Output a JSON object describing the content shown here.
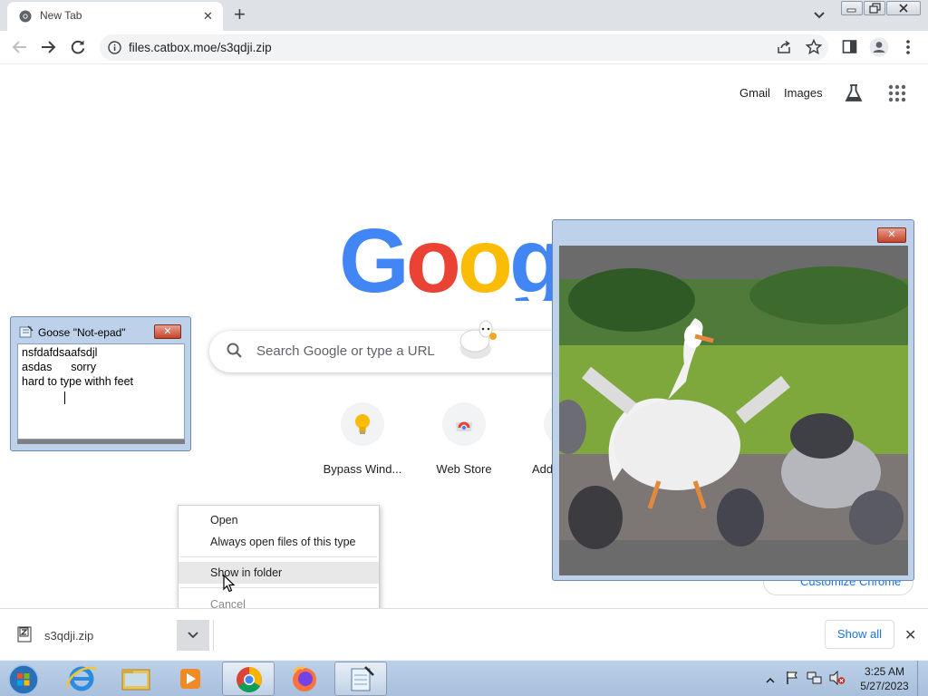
{
  "browser": {
    "tab": {
      "title": "New Tab"
    },
    "address_bar": {
      "url": "files.catbox.moe/s3qdji.zip"
    }
  },
  "ntp": {
    "header_links": {
      "gmail": "Gmail",
      "images": "Images"
    },
    "logo": {
      "visible_letters": "Googl"
    },
    "search": {
      "placeholder": "Search Google or type a URL"
    },
    "shortcuts": [
      {
        "label": "Bypass Wind...",
        "icon": "lightbulb-icon"
      },
      {
        "label": "Web Store",
        "icon": "webstore-icon"
      },
      {
        "label": "Add",
        "icon": "add-shortcut-icon"
      }
    ],
    "customize": {
      "label": "Customize Chrome"
    }
  },
  "notepad": {
    "title": "Goose \"Not-epad\"",
    "lines": [
      "nsfdafdsaafsdjl",
      "asdas      sorry",
      "hard to type withh feet"
    ]
  },
  "context_menu": {
    "items": [
      {
        "label": "Open",
        "enabled": true
      },
      {
        "label": "Always open files of this type",
        "enabled": true
      },
      {
        "label": "Show in folder",
        "enabled": true,
        "highlighted": true
      },
      {
        "label": "Cancel",
        "enabled": false
      }
    ]
  },
  "download_bar": {
    "file_name": "s3qdji.zip",
    "show_all": "Show all"
  },
  "taskbar": {
    "apps": [
      "start-orb",
      "internet-explorer",
      "file-explorer",
      "media-player",
      "chrome",
      "firefox",
      "notepad"
    ],
    "active_app": "chrome",
    "clock": {
      "time": "3:25 AM",
      "date": "5/27/2023"
    }
  },
  "colors": {
    "google_blue": "#4285f4",
    "google_red": "#ea4335",
    "google_yellow": "#fbbc05",
    "google_green": "#34a853",
    "link_blue": "#1a73e8",
    "win7_frame": "#bdd2ea"
  }
}
